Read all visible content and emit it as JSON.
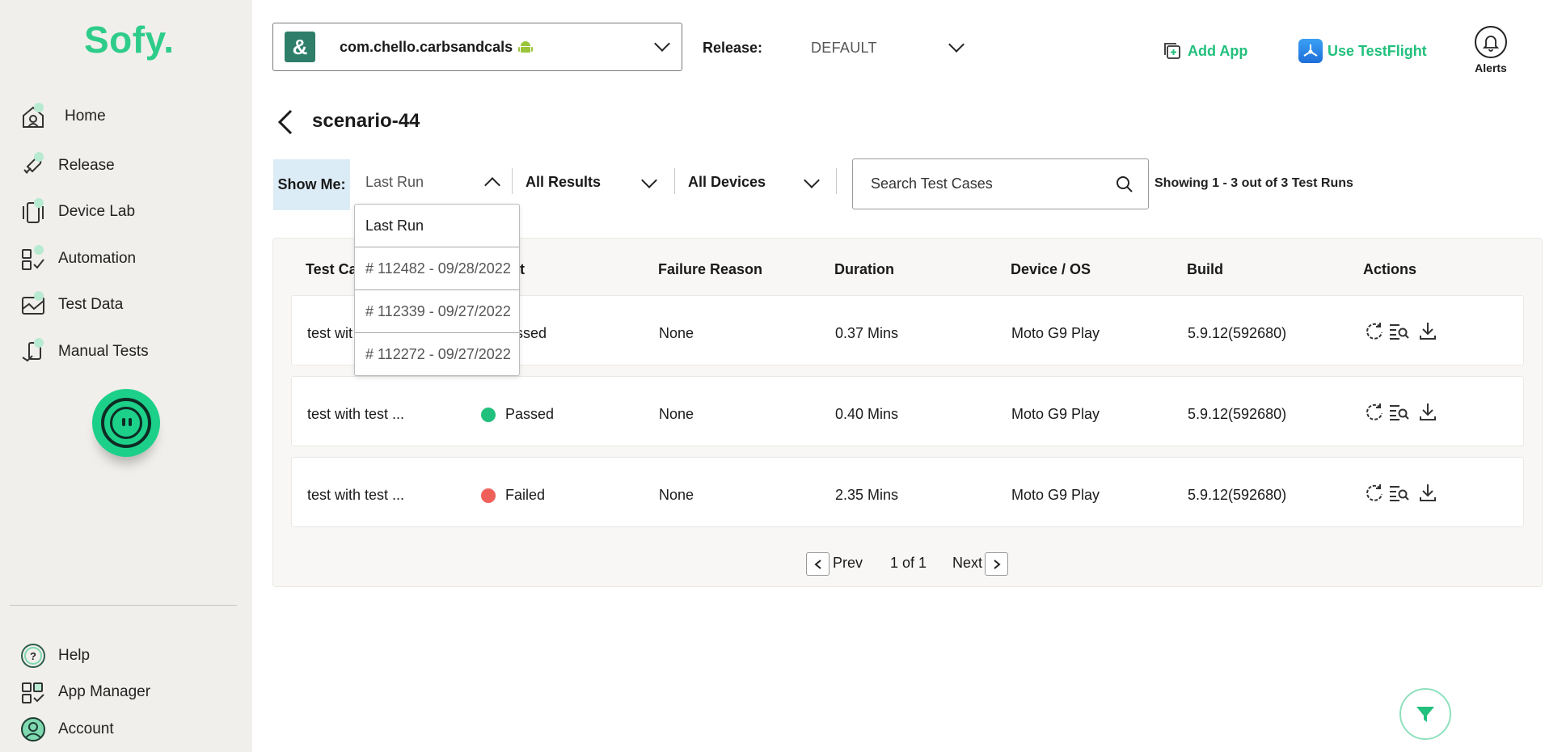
{
  "sidebar": {
    "logo": "Sofy.",
    "nav": [
      {
        "label": "Home",
        "icon": "home-icon"
      },
      {
        "label": "Release",
        "icon": "rocket-icon"
      },
      {
        "label": "Device Lab",
        "icon": "device-icon"
      },
      {
        "label": "Automation",
        "icon": "automation-icon"
      },
      {
        "label": "Test Data",
        "icon": "test-data-icon"
      },
      {
        "label": "Manual Tests",
        "icon": "manual-tests-icon"
      }
    ],
    "bottom": [
      {
        "label": "Help",
        "icon": "help-icon"
      },
      {
        "label": "App Manager",
        "icon": "app-manager-icon"
      },
      {
        "label": "Account",
        "icon": "account-icon"
      }
    ]
  },
  "header": {
    "app_name": "com.chello.carbsandcals",
    "release_label": "Release:",
    "release_value": "DEFAULT",
    "add_app": "Add App",
    "use_testflight": "Use TestFlight",
    "alerts": "Alerts"
  },
  "page": {
    "title": "scenario-44"
  },
  "filters": {
    "show_me": "Show Me:",
    "run": "Last Run",
    "results": "All Results",
    "devices": "All Devices",
    "search_placeholder": "Search Test Cases",
    "showing": "Showing 1 - 3 out of 3 Test Runs"
  },
  "run_dropdown": {
    "options": [
      "Last Run",
      "# 112482 - 09/28/2022",
      "# 112339 - 09/27/2022",
      "# 112272 - 09/27/2022"
    ]
  },
  "table": {
    "headers": {
      "test_case": "Test Ca",
      "result": "t",
      "failure_reason": "Failure Reason",
      "duration": "Duration",
      "device_os": "Device / OS",
      "build": "Build",
      "actions": "Actions"
    },
    "rows": [
      {
        "test_case": "test wit",
        "result": "assed",
        "failure_reason": "None",
        "duration": "0.37 Mins",
        "device": "Moto G9 Play",
        "build": "5.9.12(592680)",
        "status_color": ""
      },
      {
        "test_case": "test with test ...",
        "result": "Passed",
        "failure_reason": "None",
        "duration": "0.40 Mins",
        "device": "Moto G9 Play",
        "build": "5.9.12(592680)",
        "status_color": "#22c07d"
      },
      {
        "test_case": "test with test ...",
        "result": "Failed",
        "failure_reason": "None",
        "duration": "2.35 Mins",
        "device": "Moto G9 Play",
        "build": "5.9.12(592680)",
        "status_color": "#f0605a"
      }
    ]
  },
  "pagination": {
    "prev": "Prev",
    "page": "1 of 1",
    "next": "Next"
  },
  "colors": {
    "brand": "#22c07d",
    "sidebar_bg": "#f1efeb",
    "show_me_bg": "#dcecf7"
  }
}
